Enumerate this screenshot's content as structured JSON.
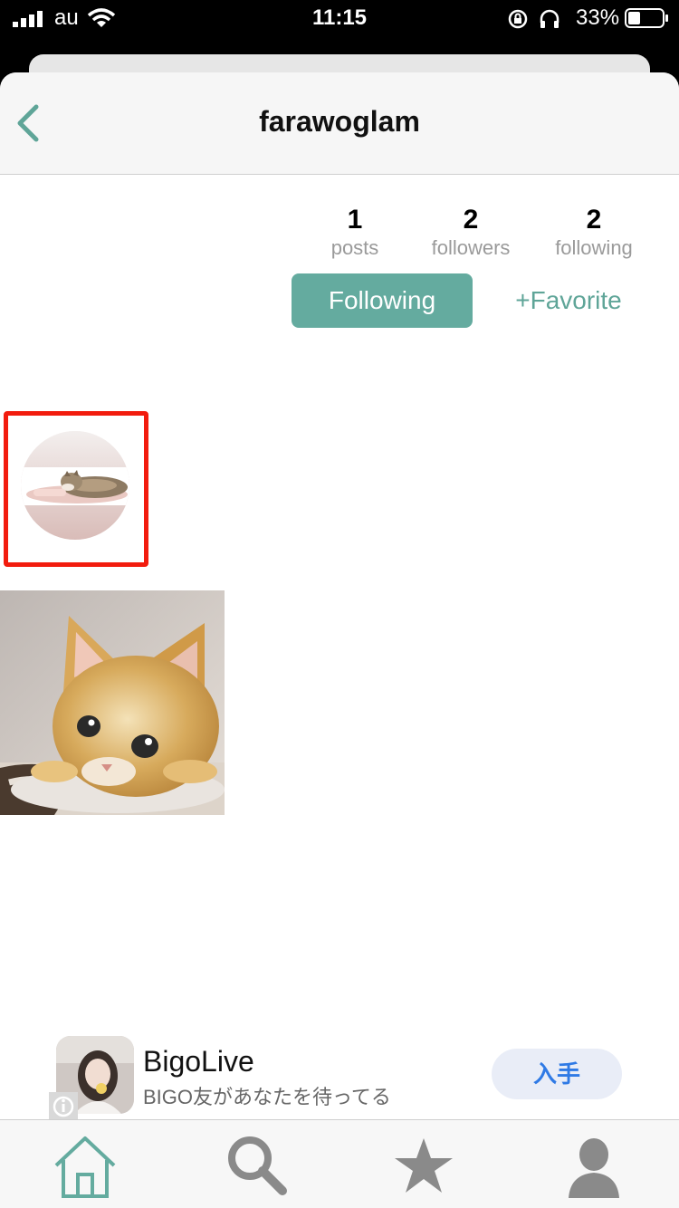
{
  "status_bar": {
    "carrier": "au",
    "time": "11:15",
    "battery": "33%"
  },
  "header": {
    "title": "farawoglam",
    "back_icon": "chevron-left-icon"
  },
  "stats": [
    {
      "value": "1",
      "label": "posts"
    },
    {
      "value": "2",
      "label": "followers"
    },
    {
      "value": "2",
      "label": "following"
    }
  ],
  "actions": {
    "following_label": "Following",
    "favorite_label": "+Favorite"
  },
  "ad": {
    "app_name": "BigoLive",
    "subtitle": "BIGO友があなたを待ってる",
    "get_label": "入手"
  },
  "tabbar": {
    "items": [
      "home-icon",
      "search-icon",
      "star-icon",
      "profile-icon"
    ]
  },
  "colors": {
    "accent": "#64ab9f",
    "highlight_border": "#f21c0e",
    "ad_button_text": "#2f7ae5"
  }
}
